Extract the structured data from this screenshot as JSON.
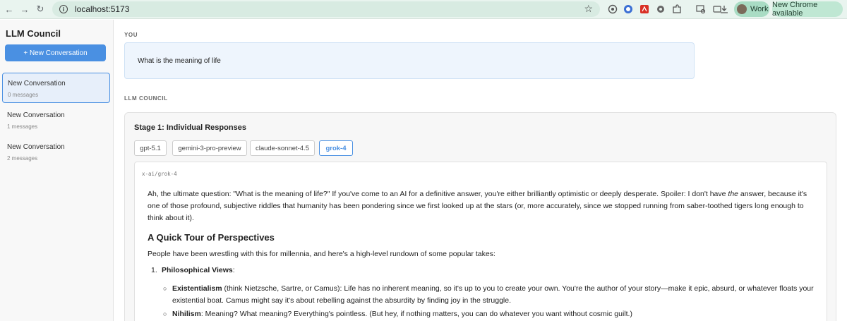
{
  "browser": {
    "url": "localhost:5173",
    "profile_label": "Work",
    "update_label": "New Chrome available"
  },
  "sidebar": {
    "title": "LLM Council",
    "new_button": "+ New Conversation",
    "conversations": [
      {
        "title": "New Conversation",
        "meta": "0 messages"
      },
      {
        "title": "New Conversation",
        "meta": "1 messages"
      },
      {
        "title": "New Conversation",
        "meta": "2 messages"
      }
    ]
  },
  "main": {
    "you_label": "YOU",
    "user_message": "What is the meaning of life",
    "council_label": "LLM COUNCIL",
    "stage_title": "Stage 1: Individual Responses",
    "tabs": [
      "gpt-5.1",
      "gemini-3-pro-preview",
      "claude-sonnet-4.5",
      "grok-4"
    ],
    "active_tab": "grok-4",
    "model_id": "x-ai/grok-4",
    "response": {
      "intro_a": "Ah, the ultimate question: \"What is the meaning of life?\" If you've come to an AI for a definitive answer, you're either brilliantly optimistic or deeply desperate. Spoiler: I don't have ",
      "intro_em": "the",
      "intro_b": " answer, because it's one of those profound, subjective riddles that humanity has been pondering since we first looked up at the stars (or, more accurately, since we stopped running from saber-toothed tigers long enough to think about it).",
      "heading": "A Quick Tour of Perspectives",
      "lead": "People have been wrestling with this for millennia, and here's a high-level rundown of some popular takes:",
      "item1_num": "1.",
      "item1_title": "Philosophical Views",
      "item1_colon": ":",
      "sub1_title": "Existentialism",
      "sub1_text": " (think Nietzsche, Sartre, or Camus): Life has no inherent meaning, so it's up to you to create your own. You're the author of your story—make it epic, absurd, or whatever floats your existential boat. Camus might say it's about rebelling against the absurdity by finding joy in the struggle.",
      "sub2_title": "Nihilism",
      "sub2_text": ": Meaning? What meaning? Everything's pointless. (But hey, if nothing matters, you can do whatever you want without cosmic guilt.)"
    }
  }
}
